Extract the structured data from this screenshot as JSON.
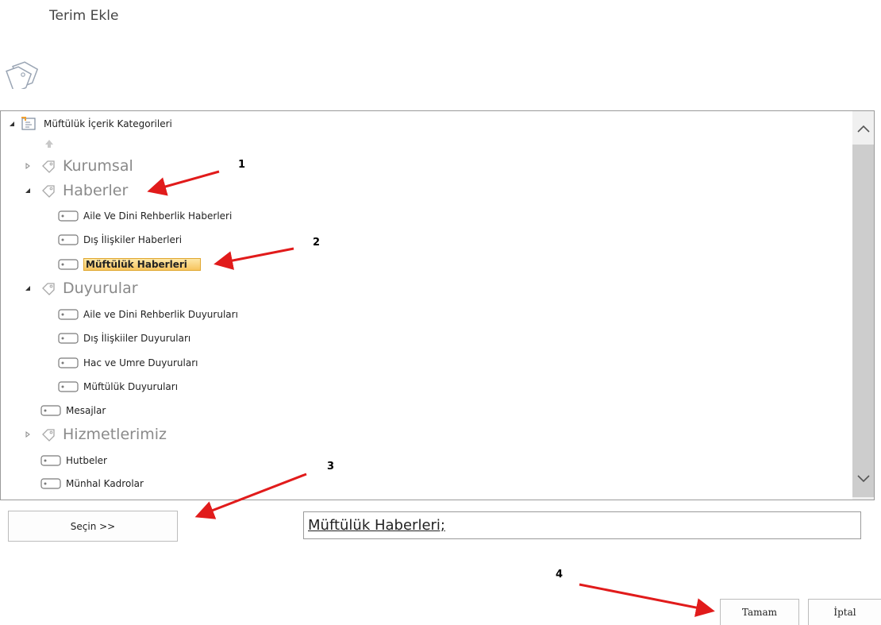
{
  "dialog": {
    "title": "Terim Ekle",
    "logo_icon": "tags-icon"
  },
  "tree": {
    "root": {
      "label": "Müftülük İçerik Kategorileri",
      "icon": "termstore-icon",
      "expanded": true
    },
    "up_icon": "up-arrow-icon",
    "items": [
      {
        "label": "Kurumsal",
        "level": 1,
        "kind": "set",
        "expanded": false
      },
      {
        "label": "Haberler",
        "level": 1,
        "kind": "set",
        "expanded": true
      },
      {
        "label": "Aile Ve Dini Rehberlik Haberleri",
        "level": 2,
        "kind": "term"
      },
      {
        "label": "Dış İlişkiler Haberleri",
        "level": 2,
        "kind": "term"
      },
      {
        "label": "Müftülük Haberleri",
        "level": 2,
        "kind": "term",
        "selected": true
      },
      {
        "label": "Duyurular",
        "level": 1,
        "kind": "set",
        "expanded": true
      },
      {
        "label": "Aile ve Dini Rehberlik Duyuruları",
        "level": 2,
        "kind": "term"
      },
      {
        "label": "Dış İlişkiiler Duyuruları",
        "level": 2,
        "kind": "term"
      },
      {
        "label": "Hac ve Umre Duyuruları",
        "level": 2,
        "kind": "term"
      },
      {
        "label": "Müftülük Duyuruları",
        "level": 2,
        "kind": "term"
      },
      {
        "label": "Mesajlar",
        "level": 1,
        "kind": "term"
      },
      {
        "label": "Hizmetlerimiz",
        "level": 1,
        "kind": "set",
        "expanded": false
      },
      {
        "label": "Hutbeler",
        "level": 1,
        "kind": "term"
      },
      {
        "label": "Münhal Kadrolar",
        "level": 1,
        "kind": "term"
      }
    ]
  },
  "select_button": {
    "label": "Seçin >>"
  },
  "selected_value": "Müftülük Haberleri;",
  "buttons": {
    "ok": "Tamam",
    "cancel": "İptal"
  },
  "annotations": [
    "1",
    "2",
    "3",
    "4"
  ],
  "colors": {
    "selection": "#f7c45e",
    "arrow": "#e11b1b"
  }
}
